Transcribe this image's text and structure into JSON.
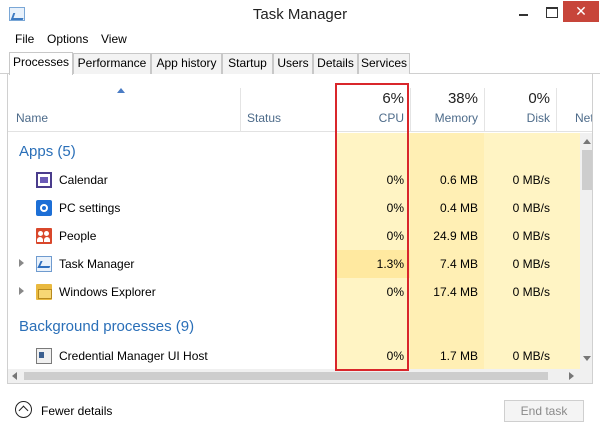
{
  "window": {
    "title": "Task Manager"
  },
  "menu": [
    "File",
    "Options",
    "View"
  ],
  "tabs": [
    "Processes",
    "Performance",
    "App history",
    "Startup",
    "Users",
    "Details",
    "Services"
  ],
  "active_tab": "Processes",
  "columns": {
    "name": "Name",
    "status": "Status",
    "cpu": {
      "pct": "6%",
      "label": "CPU"
    },
    "memory": {
      "pct": "38%",
      "label": "Memory"
    },
    "disk": {
      "pct": "0%",
      "label": "Disk"
    },
    "network": {
      "label": "Net"
    }
  },
  "groups": {
    "apps": "Apps (5)",
    "background": "Background processes (9)"
  },
  "rows": [
    {
      "name": "Calendar",
      "icon": "calendar-icon",
      "expandable": false,
      "cpu": "0%",
      "memory": "0.6 MB",
      "disk": "0 MB/s"
    },
    {
      "name": "PC settings",
      "icon": "settings-icon",
      "expandable": false,
      "cpu": "0%",
      "memory": "0.4 MB",
      "disk": "0 MB/s"
    },
    {
      "name": "People",
      "icon": "people-icon",
      "expandable": false,
      "cpu": "0%",
      "memory": "24.9 MB",
      "disk": "0 MB/s"
    },
    {
      "name": "Task Manager",
      "icon": "task-manager-icon",
      "expandable": true,
      "cpu": "1.3%",
      "memory": "7.4 MB",
      "disk": "0 MB/s"
    },
    {
      "name": "Windows Explorer",
      "icon": "folder-icon",
      "expandable": true,
      "cpu": "0%",
      "memory": "17.4 MB",
      "disk": "0 MB/s"
    },
    {
      "name": "Credential Manager UI Host",
      "icon": "credential-icon",
      "expandable": false,
      "cpu": "0%",
      "memory": "1.7 MB",
      "disk": "0 MB/s"
    }
  ],
  "footer": {
    "fewer_details": "Fewer details",
    "end_task": "End task"
  },
  "colors": {
    "heat_light": "#fff4c4",
    "heat_medium": "#ffe9a0",
    "group_title": "#2a6fb8",
    "highlight": "#d9262b",
    "close_button": "#c7453a"
  }
}
